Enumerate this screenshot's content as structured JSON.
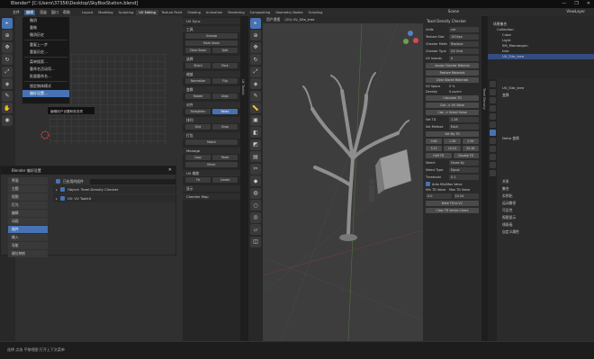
{
  "window": {
    "title": "Blender* [C:\\Users\\37356\\Desktop\\SkyBoxStation.blend]",
    "controls": [
      "—",
      "❐",
      "✕"
    ]
  },
  "menubar": {
    "items": [
      "文件",
      "编辑",
      "渲染",
      "窗口",
      "帮助"
    ],
    "active_index": 1
  },
  "workspace_tabs": [
    "Layout",
    "Modeling",
    "Sculpting",
    "UV Editing",
    "Texture Paint",
    "Shading",
    "Animation",
    "Rendering",
    "Compositing",
    "Geometry Nodes",
    "Scripting"
  ],
  "workspace_active_index": 3,
  "scene": "Scene",
  "view_layer": "ViewLayer",
  "edit_menu": {
    "items": [
      "撤消",
      "重做",
      "撤消历史",
      "重复上一步",
      "重复历史…",
      "菜单搜索…",
      "重命名活动项…",
      "批量重命名…",
      "锁定物体模式",
      "偏好设置…"
    ],
    "selected_index": 9
  },
  "tooltip": "编辑用户设置和首选项",
  "preferences": {
    "title": "Blender 偏好设置",
    "tabs": [
      "界面",
      "主题",
      "视图",
      "灯光",
      "编辑",
      "动画",
      "插件",
      "输入",
      "导航",
      "键位映射",
      "系统",
      "保存&加载",
      "文件路径"
    ],
    "active_tab": 6,
    "filter_label": "已启用的插件",
    "addons": [
      {
        "name": "Object: Texel Density Checker",
        "enabled": true
      },
      {
        "name": "UV: UV Toolkit",
        "enabled": true
      }
    ]
  },
  "uv_panel": {
    "title": "UV Sync",
    "sections": [
      "工具",
      "选择",
      "缩放",
      "变换",
      "对齐",
      "排列",
      "打包",
      "Manage",
      "UV 缩放",
      "显示",
      "Checker Map"
    ],
    "buttons": [
      "Unwrap",
      "Mark Seam",
      "Clear Seam",
      "Split",
      "Stitch",
      "Pack",
      "Normalize",
      "Flip",
      "Rotate",
      "Align",
      "Straighten",
      "Relax",
      "Grid",
      "Snap",
      "Match",
      "Copy",
      "Paste",
      "Mirror",
      "Fit",
      "Create"
    ]
  },
  "viewport": {
    "header": "用户透视",
    "sub": "(20) UV_Site_tree"
  },
  "texel_panel": {
    "title": "Texel Density Checker",
    "rows": [
      {
        "label": "Units",
        "value": "cm"
      },
      {
        "label": "Texture Size",
        "value": "1024px"
      },
      {
        "label": "Checker Method",
        "value": "Replace"
      },
      {
        "label": "Checker Type",
        "value": "UV Grid"
      },
      {
        "label": "UV Islands",
        "value": "0"
      }
    ],
    "buttons": [
      "Assign Checker Material",
      "Restore Materials",
      "Clear Stored Materials"
    ],
    "uv_space_label": "UV Space",
    "uv_space": "0 %",
    "density_label": "Density",
    "density": "0 px/cm",
    "calc_buttons": [
      "Calculate TD",
      "Calc -> UV Value",
      "Calc -> Select Value"
    ],
    "set_td_label": "Set TD",
    "set_td": "1.28",
    "set_method_label": "Set Method",
    "set_method": "Each",
    "set_buttons": [
      "Set My TD",
      "0.64",
      "1.28",
      "2.56",
      "5.12",
      "10.24",
      "20.48",
      "Half TD",
      "Double TD"
    ],
    "select_label": "Select",
    "select_value": "Faces By",
    "select_type_label": "Select Type",
    "select_type": "Equal",
    "thresh_label": "Threshold",
    "thresh": "0.1",
    "checkbox": "Auto Min/Max Value",
    "minmax_labels": [
      "Min TD Value",
      "Max TD Value"
    ],
    "minmax": [
      "0.0",
      "10.24"
    ],
    "bake_button": "Bake TD to VC",
    "clear_button": "Clear TD Vertex Colors"
  },
  "outliner": {
    "rows": [
      "场景集合",
      "Collection",
      "Cube",
      "Light",
      "SM_Mannequin",
      "tree",
      "UV_Site_tree"
    ]
  },
  "properties": {
    "rows": [
      "UV_Site_tree",
      "变换",
      "Delta 变换",
      "关系",
      "集合",
      "实例化",
      "运动路径",
      "可见性",
      "视图显示",
      "线条画",
      "自定义属性"
    ]
  },
  "status": "选择  点选  平移视图  打开上下文菜单"
}
